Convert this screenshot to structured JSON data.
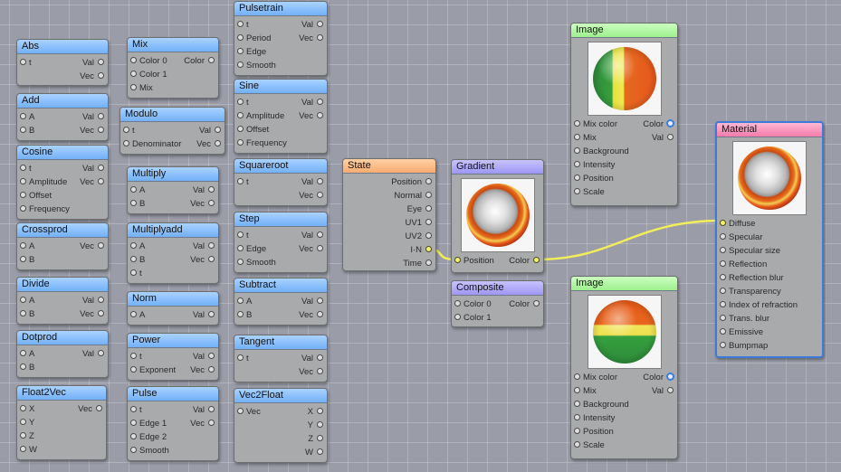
{
  "nodes": {
    "abs": {
      "title": "Abs",
      "inputs": [
        "t"
      ],
      "outputs": [
        "Val",
        "Vec"
      ]
    },
    "add": {
      "title": "Add",
      "inputs": [
        "A",
        "B"
      ],
      "outputs": [
        "Val",
        "Vec"
      ]
    },
    "cosine": {
      "title": "Cosine",
      "inputs": [
        "t",
        "Amplitude",
        "Offset",
        "Frequency"
      ],
      "outputs": [
        "Val",
        "Vec"
      ]
    },
    "crossprod": {
      "title": "Crossprod",
      "inputs": [
        "A",
        "B"
      ],
      "outputs": [
        "Vec"
      ]
    },
    "divide": {
      "title": "Divide",
      "inputs": [
        "A",
        "B"
      ],
      "outputs": [
        "Val",
        "Vec"
      ]
    },
    "dotprod": {
      "title": "Dotprod",
      "inputs": [
        "A",
        "B"
      ],
      "outputs": [
        "Val"
      ]
    },
    "float2vec": {
      "title": "Float2Vec",
      "inputs": [
        "X",
        "Y",
        "Z",
        "W"
      ],
      "outputs": [
        "Vec"
      ]
    },
    "mix": {
      "title": "Mix",
      "inputs": [
        "Color 0",
        "Color 1",
        "Mix"
      ],
      "outputs": [
        "Color"
      ]
    },
    "modulo": {
      "title": "Modulo",
      "inputs": [
        "t",
        "Denominator"
      ],
      "outputs": [
        "Val",
        "Vec"
      ]
    },
    "multiply": {
      "title": "Multiply",
      "inputs": [
        "A",
        "B"
      ],
      "outputs": [
        "Val",
        "Vec"
      ]
    },
    "multiplyadd": {
      "title": "Multiplyadd",
      "inputs": [
        "A",
        "B",
        "t"
      ],
      "outputs": [
        "Val",
        "Vec"
      ]
    },
    "norm": {
      "title": "Norm",
      "inputs": [
        "A"
      ],
      "outputs": [
        "Val"
      ]
    },
    "power": {
      "title": "Power",
      "inputs": [
        "t",
        "Exponent"
      ],
      "outputs": [
        "Val",
        "Vec"
      ]
    },
    "pulse": {
      "title": "Pulse",
      "inputs": [
        "t",
        "Edge 1",
        "Edge 2",
        "Smooth"
      ],
      "outputs": [
        "Val",
        "Vec"
      ]
    },
    "pulsetrain": {
      "title": "Pulsetrain",
      "inputs": [
        "t",
        "Period",
        "Edge",
        "Smooth"
      ],
      "outputs": [
        "Val",
        "Vec"
      ]
    },
    "sine": {
      "title": "Sine",
      "inputs": [
        "t",
        "Amplitude",
        "Offset",
        "Frequency"
      ],
      "outputs": [
        "Val",
        "Vec"
      ]
    },
    "squareroot": {
      "title": "Squareroot",
      "inputs": [
        "t"
      ],
      "outputs": [
        "Val",
        "Vec"
      ]
    },
    "step": {
      "title": "Step",
      "inputs": [
        "t",
        "Edge",
        "Smooth"
      ],
      "outputs": [
        "Val",
        "Vec"
      ]
    },
    "subtract": {
      "title": "Subtract",
      "inputs": [
        "A",
        "B"
      ],
      "outputs": [
        "Val",
        "Vec"
      ]
    },
    "tangent": {
      "title": "Tangent",
      "inputs": [
        "t"
      ],
      "outputs": [
        "Val",
        "Vec"
      ]
    },
    "vec2float": {
      "title": "Vec2Float",
      "inputs": [
        "Vec"
      ],
      "outputs": [
        "X",
        "Y",
        "Z",
        "W"
      ]
    },
    "state": {
      "title": "State",
      "inputs": [],
      "outputs": [
        "Position",
        "Normal",
        "Eye",
        "UV1",
        "UV2",
        "I·N",
        "Time"
      ]
    },
    "gradient": {
      "title": "Gradient",
      "inputs": [
        "Position"
      ],
      "outputs": [
        "Color"
      ]
    },
    "composite": {
      "title": "Composite",
      "inputs": [
        "Color 0",
        "Color 1"
      ],
      "outputs": [
        "Color"
      ]
    },
    "image1": {
      "title": "Image",
      "inputs": [
        "Mix color",
        "Mix",
        "Background",
        "Intensity",
        "Position",
        "Scale"
      ],
      "outputs": [
        "Color",
        "Val"
      ]
    },
    "image2": {
      "title": "Image",
      "inputs": [
        "Mix color",
        "Mix",
        "Background",
        "Intensity",
        "Position",
        "Scale"
      ],
      "outputs": [
        "Color",
        "Val"
      ]
    },
    "material": {
      "title": "Material",
      "inputs": [
        "Diffuse",
        "Specular",
        "Specular size",
        "Reflection",
        "Reflection blur",
        "Transparency",
        "Index of refraction",
        "Trans. blur",
        "Emissive",
        "Bumpmap"
      ],
      "outputs": []
    }
  },
  "colors": {
    "wire": "#f2ee5a",
    "selected_border": "#3e7bd9",
    "header_blue": "#8dc1fb",
    "header_orange": "#fbbb85",
    "header_purple": "#aea8f8",
    "header_green": "#b0f5a0",
    "header_pink": "#f690b8",
    "canvas": "#9a9ca8"
  }
}
